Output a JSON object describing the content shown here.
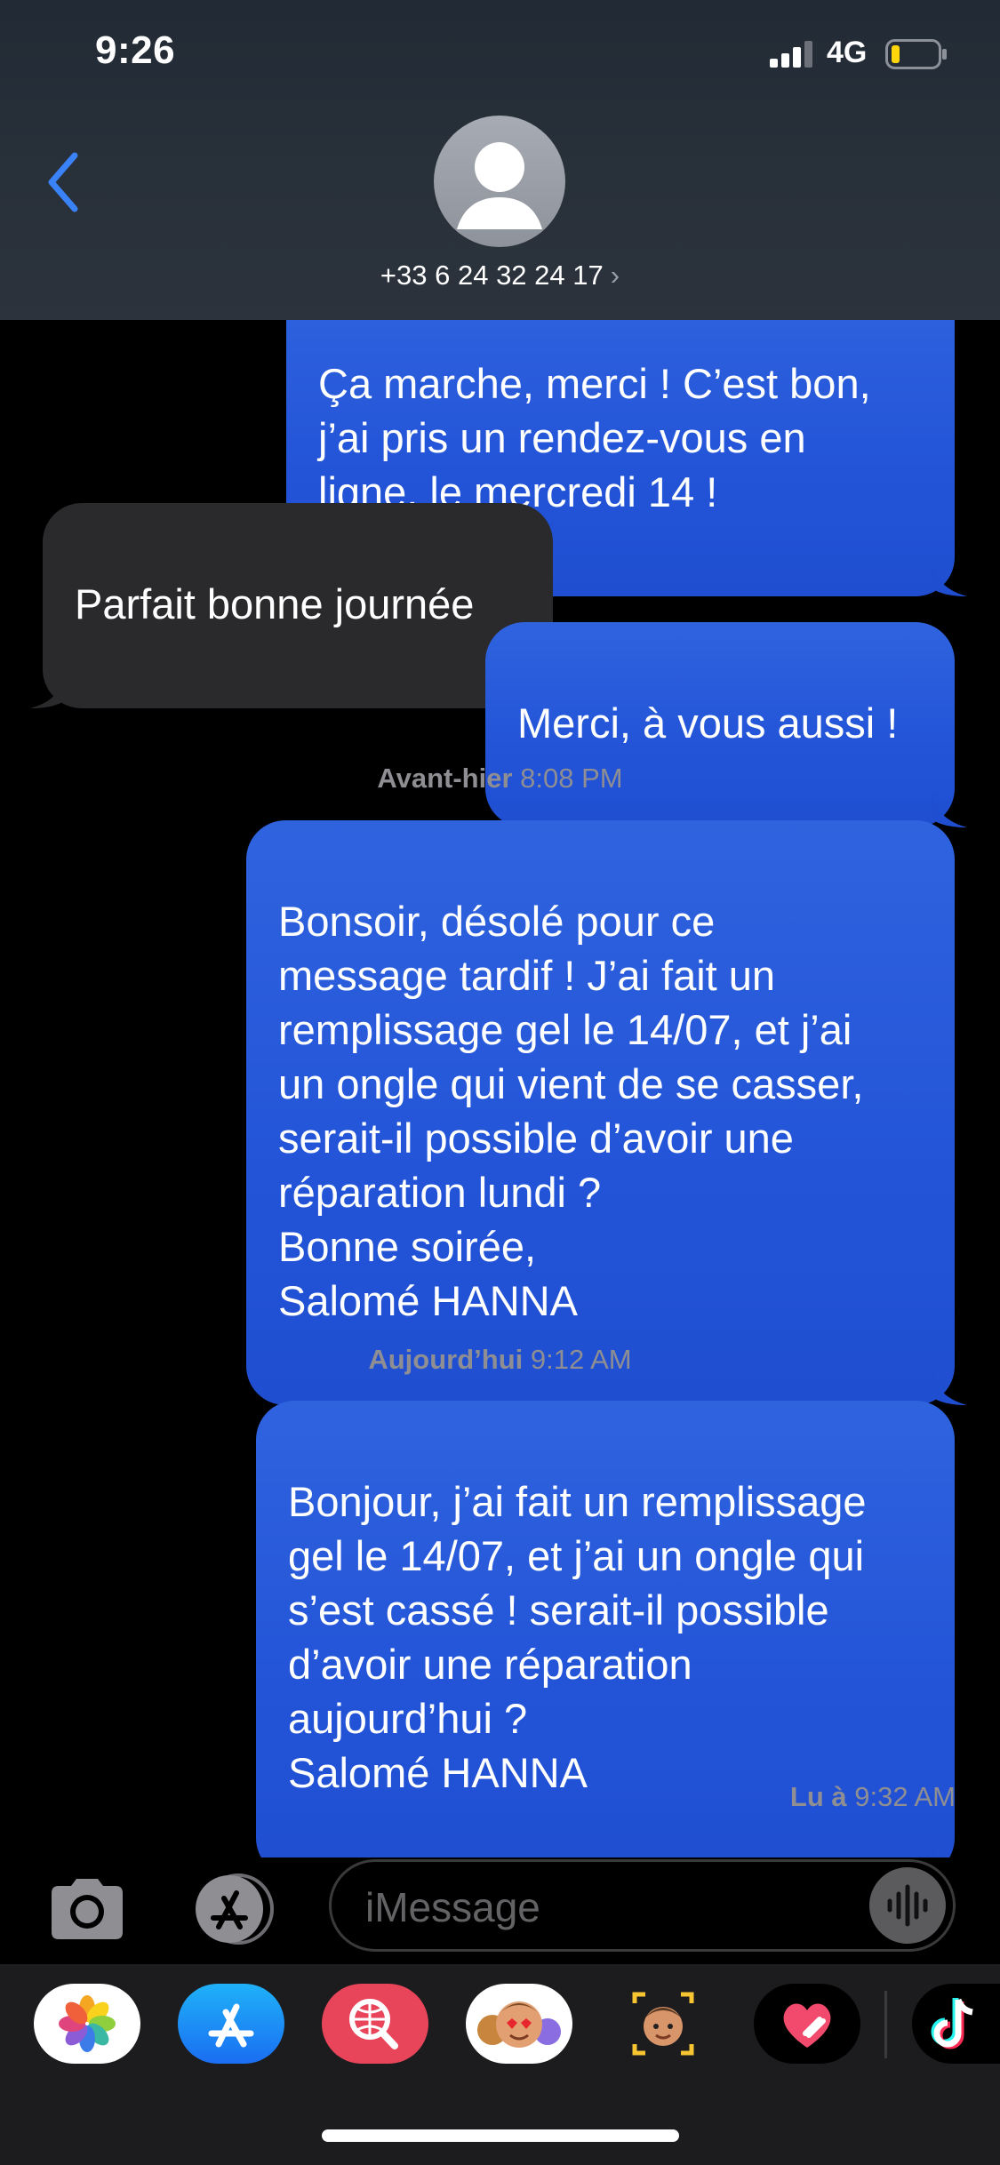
{
  "status_bar": {
    "time": "9:26",
    "network": "4G"
  },
  "header": {
    "contact": "+33 6 24 32 24 17",
    "contact_chevron": "›"
  },
  "messages": [
    {
      "dir": "sent",
      "text": "Ça marche, merci ! C’est bon,\nj’ai pris un rendez-vous en\nligne, le mercredi 14 !"
    },
    {
      "dir": "received",
      "text": "Parfait bonne journée"
    },
    {
      "dir": "sent",
      "text": "Merci, à vous aussi !"
    },
    {
      "dir": "sent",
      "text": "Bonsoir, désolé pour ce\nmessage tardif ! J’ai fait un\nremplissage gel le 14/07, et j’ai\nun ongle qui vient de se casser,\nserait-il possible d’avoir une\nréparation lundi ?\nBonne soirée,\nSalomé HANNA"
    },
    {
      "dir": "sent",
      "text": "Bonjour, j’ai fait un remplissage\ngel le 14/07, et j’ai un ongle qui\ns’est cassé ! serait-il possible\nd’avoir une réparation\naujourd’hui ?\nSalomé HANNA"
    }
  ],
  "timestamps": [
    {
      "day": "Avant-hier",
      "time": "8:08 PM"
    },
    {
      "day": "Aujourd’hui",
      "time": "9:12 AM"
    }
  ],
  "read_receipt": {
    "label": "Lu à",
    "time": "9:32 AM"
  },
  "input": {
    "placeholder": "iMessage"
  },
  "icons": {
    "back": "chevron-left-icon",
    "camera": "camera-icon",
    "apps": "app-store-icon",
    "audio": "waveform-icon"
  },
  "app_drawer": [
    "photos",
    "app-store",
    "web-search",
    "memoji-stickers",
    "memoji",
    "digital-touch",
    "tiktok"
  ],
  "colors": {
    "sent_bubble": "#2354d8",
    "received_bubble": "#2a2a2c",
    "accent": "#3a82f7",
    "header_bg": "#28303a",
    "battery_low": "#ffd60a"
  }
}
